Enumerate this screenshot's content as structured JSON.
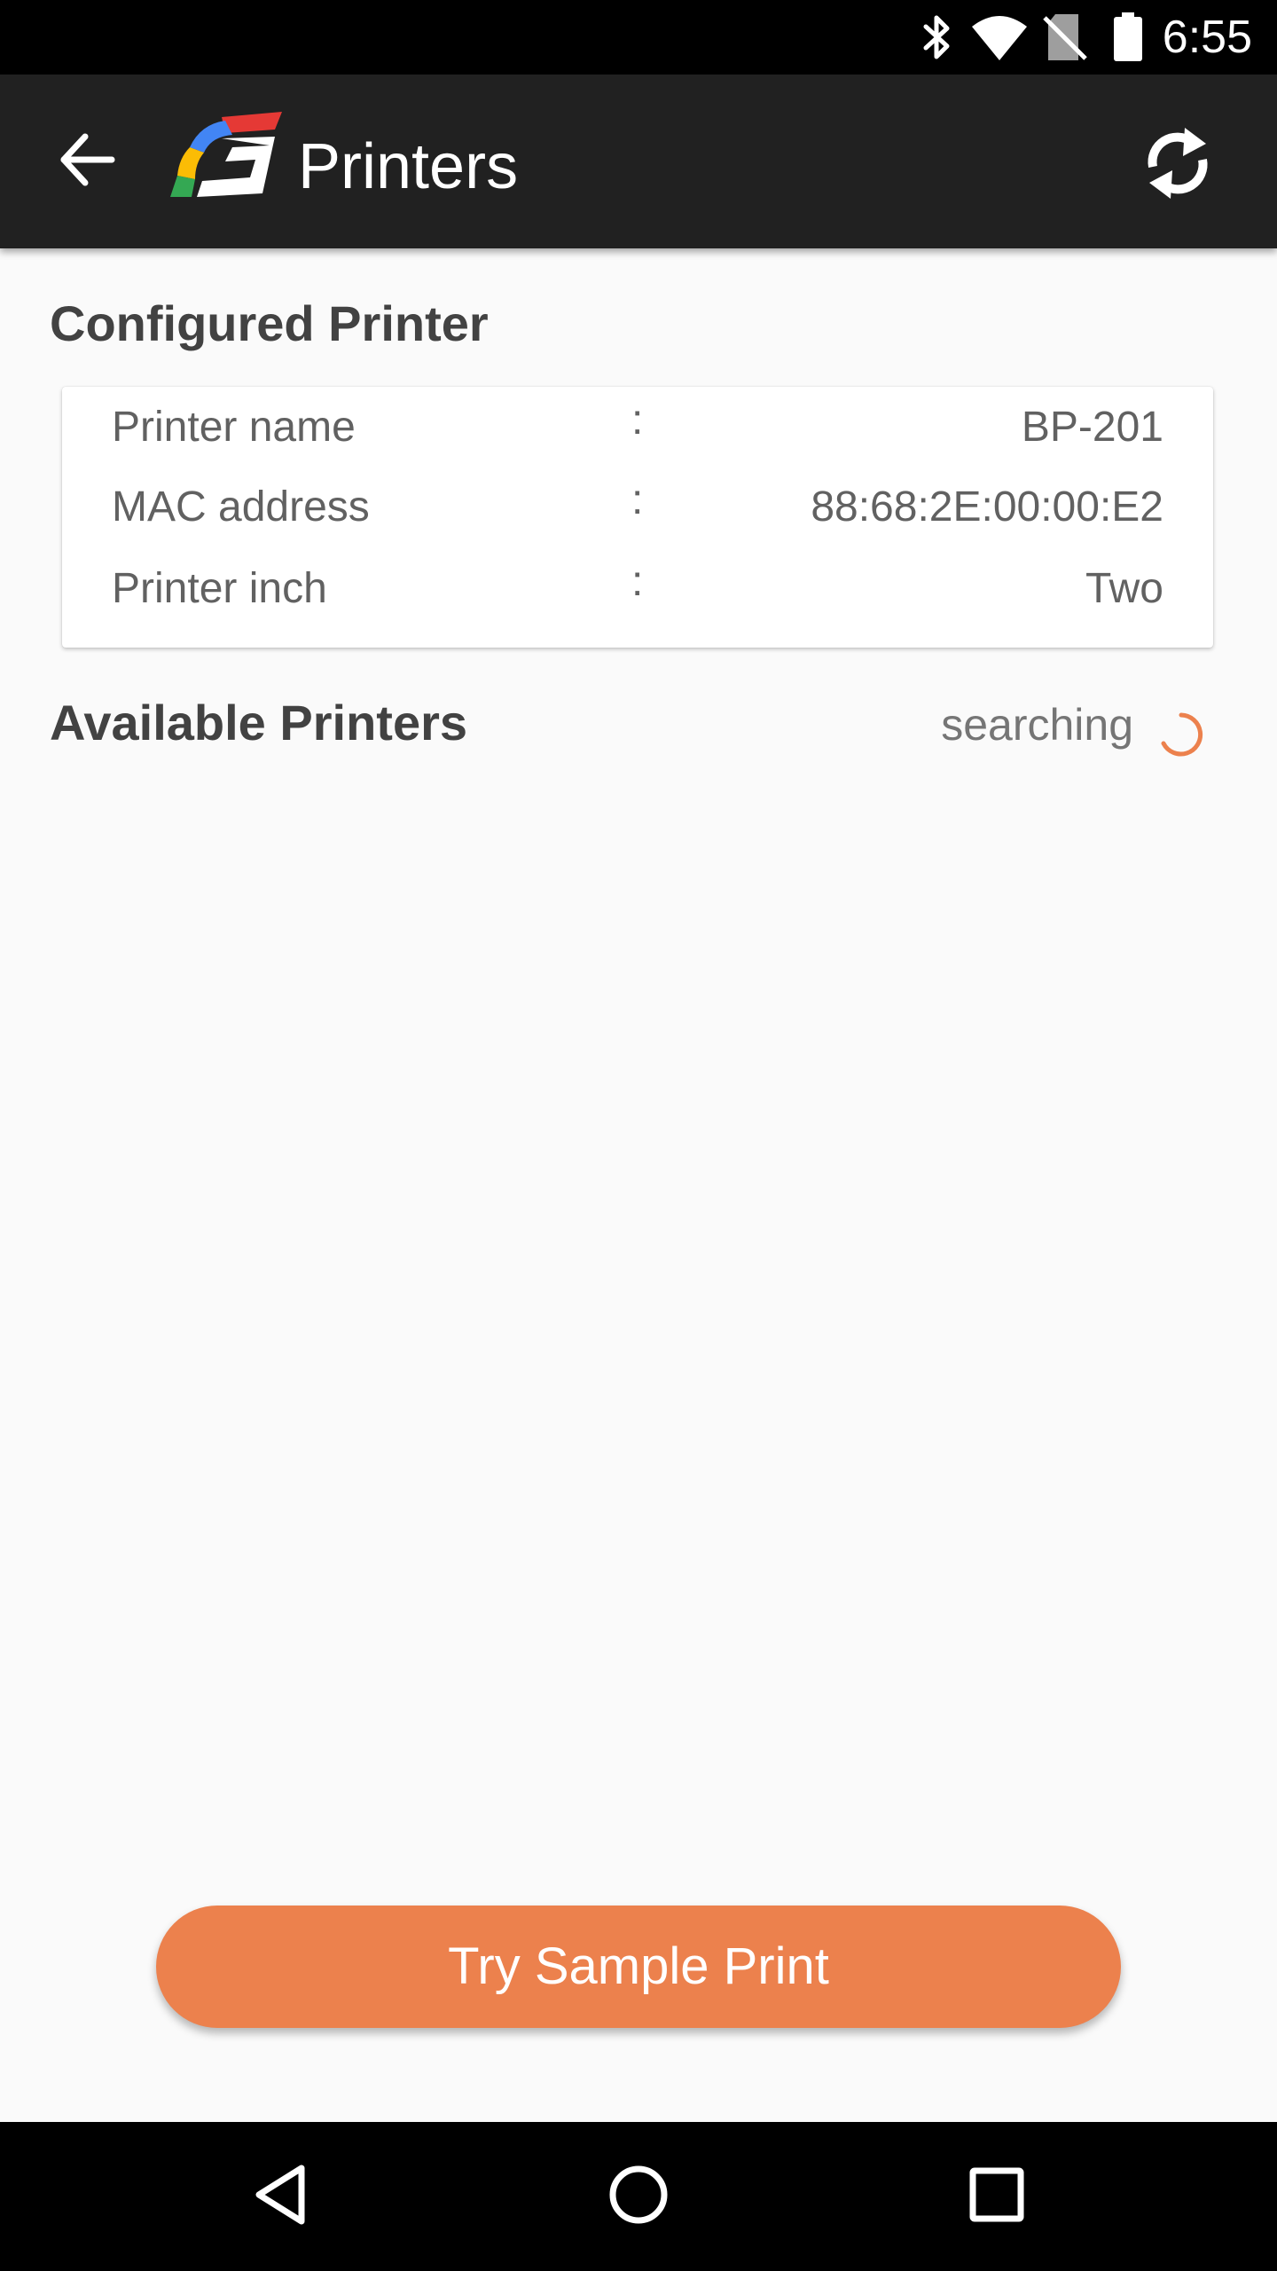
{
  "status_bar": {
    "time": "6:55",
    "icons": [
      "bluetooth-icon",
      "wifi-icon",
      "no-sim-icon",
      "battery-icon"
    ]
  },
  "app_bar": {
    "title": "Printers",
    "back_icon": "arrow-back-icon",
    "refresh_icon": "refresh-icon",
    "logo_colors": [
      "#e53935",
      "#4285f4",
      "#fbbc05",
      "#34a853"
    ]
  },
  "configured_printer": {
    "heading": "Configured Printer",
    "separator": ":",
    "rows": [
      {
        "label": "Printer name",
        "value": "BP-201"
      },
      {
        "label": "MAC address",
        "value": "88:68:2E:00:00:E2"
      },
      {
        "label": "Printer inch",
        "value": "Two"
      }
    ]
  },
  "available_printers": {
    "heading": "Available Printers",
    "status": "searching"
  },
  "actions": {
    "sample_print_label": "Try Sample Print"
  },
  "nav_bar": {
    "icons": [
      "nav-back-icon",
      "nav-home-icon",
      "nav-recents-icon"
    ]
  },
  "colors": {
    "accent": "#ec814d",
    "app_bar": "#212121",
    "background": "#fafafa"
  }
}
